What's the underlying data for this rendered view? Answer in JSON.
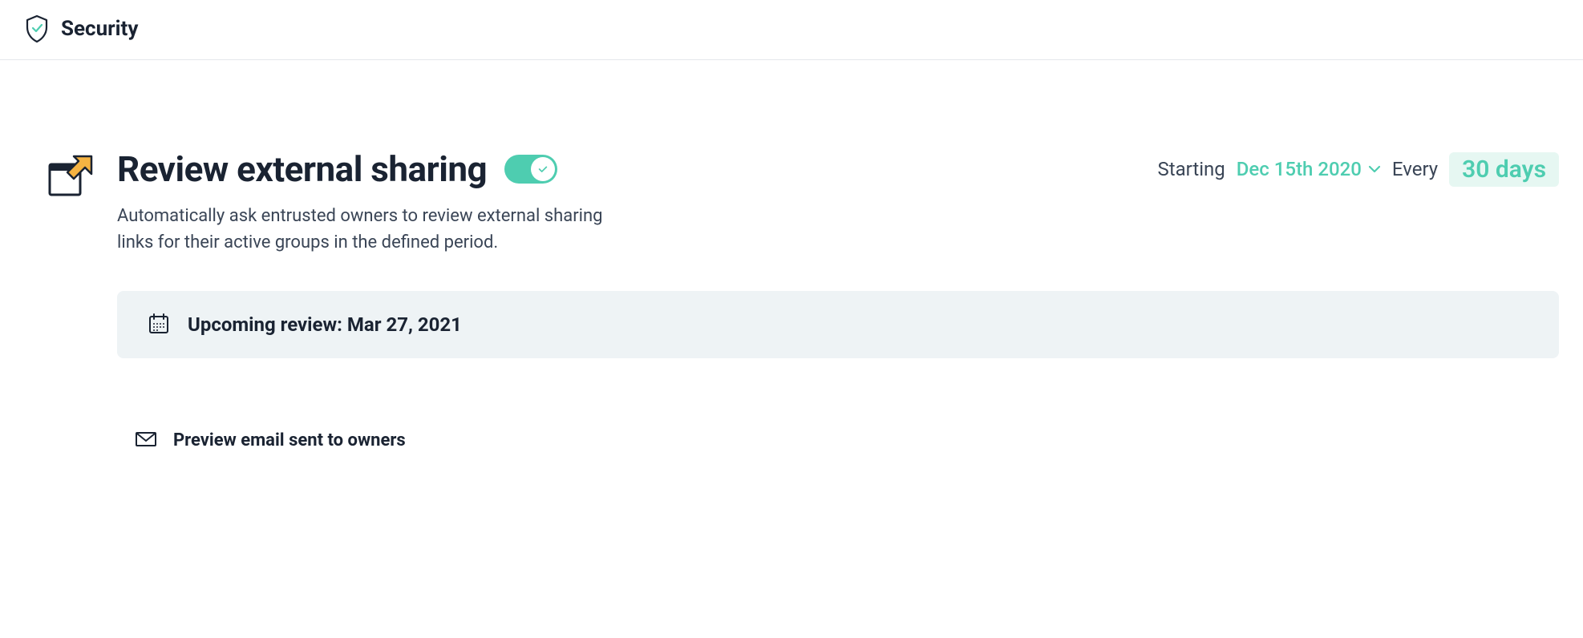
{
  "header": {
    "title": "Security"
  },
  "feature": {
    "title": "Review external sharing",
    "toggle_enabled": true,
    "description": "Automatically ask entrusted owners to review external sharing links for their active groups in the defined period.",
    "starting_label": "Starting",
    "starting_date": "Dec 15th 2020",
    "every_label": "Every",
    "every_value": "30 days"
  },
  "upcoming": {
    "label": "Upcoming review: Mar 27, 2021"
  },
  "preview": {
    "label": "Preview email sent to owners"
  }
}
